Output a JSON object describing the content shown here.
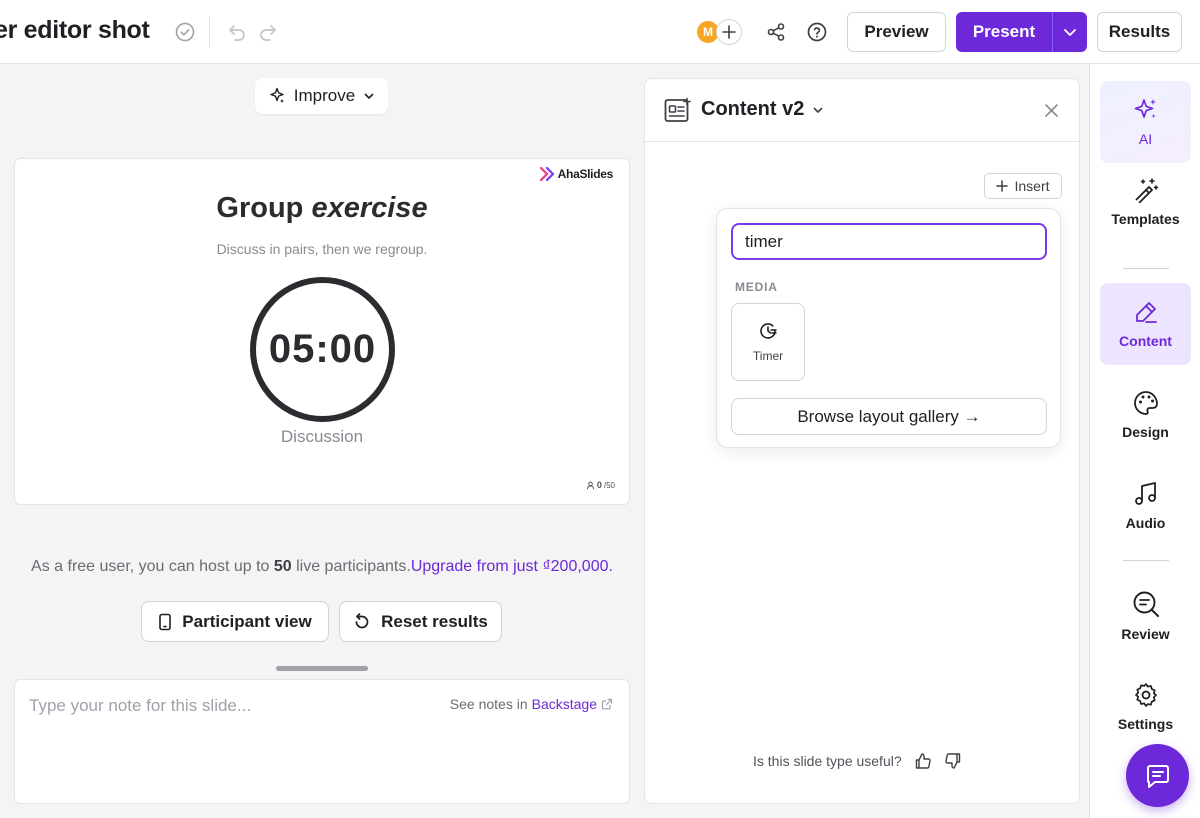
{
  "header": {
    "doc_title": "er editor shot",
    "avatar_initial": "M",
    "preview_label": "Preview",
    "present_label": "Present",
    "results_label": "Results"
  },
  "canvas": {
    "improve_label": "Improve",
    "slide": {
      "brand": "AhaSlides",
      "title_main": "Group ",
      "title_emph": "exercise",
      "subtitle": "Discuss in pairs, then we regroup.",
      "timer_value": "05:00",
      "timer_caption": "Discussion",
      "participants_count": "0",
      "participants_max": "/50"
    },
    "free_note": {
      "prefix": "As a free user, you can host up to ",
      "limit": "50",
      "suffix": " live participants.",
      "upgrade_link": "Upgrade from just ₫200,000."
    },
    "participant_view_label": "Participant view",
    "reset_results_label": "Reset results",
    "notes": {
      "placeholder": "Type your note for this slide...",
      "backstage_prefix": "See notes in ",
      "backstage_link": "Backstage"
    }
  },
  "content_panel": {
    "title": "Content v2",
    "insert_label": "Insert",
    "search_value": "timer",
    "section_label": "MEDIA",
    "timer_item_label": "Timer",
    "browse_label": "Browse layout gallery →",
    "feedback_question": "Is this slide type useful?"
  },
  "sidebar": {
    "items": [
      {
        "label": "AI",
        "icon": "sparkle-icon"
      },
      {
        "label": "Templates",
        "icon": "magic-wand-icon"
      },
      {
        "label": "Content",
        "icon": "pencil-icon"
      },
      {
        "label": "Design",
        "icon": "palette-icon"
      },
      {
        "label": "Audio",
        "icon": "music-note-icon"
      },
      {
        "label": "Review",
        "icon": "review-search-icon"
      },
      {
        "label": "Settings",
        "icon": "gear-icon"
      }
    ]
  },
  "colors": {
    "accent": "#6d28d9",
    "avatar": "#f5a623",
    "active_bg": "#ede4fd"
  }
}
